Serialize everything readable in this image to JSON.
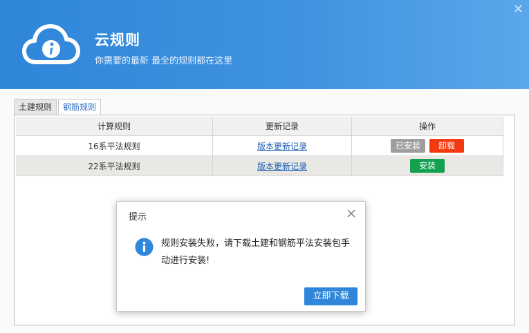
{
  "header": {
    "title": "云规则",
    "subtitle": "你需要的最新 最全的规则都在这里",
    "close_glyph": "✕",
    "logo_icon": "cloud-info-icon"
  },
  "tabs": [
    {
      "label": "土建规则",
      "active": false
    },
    {
      "label": "钢筋规则",
      "active": true
    }
  ],
  "table": {
    "columns": [
      "计算规则",
      "更新记录",
      "操作"
    ],
    "rows": [
      {
        "name": "16系平法规则",
        "log_link": "版本更新记录",
        "actions": [
          "已安装",
          "卸载"
        ]
      },
      {
        "name": "22系平法规则",
        "log_link": "版本更新记录",
        "actions": [
          "安装"
        ]
      }
    ]
  },
  "dialog": {
    "title": "提示",
    "message": "规则安装失败，请下载土建和钢筋平法安装包手动进行安装!",
    "button": "立即下载"
  },
  "colors": {
    "header_blue": "#3f92e0",
    "installed_gray": "#9e9e9e",
    "uninstall_red": "#f2390f",
    "install_green": "#13a150",
    "primary_button": "#2f86db",
    "link_blue": "#1e5fb4"
  }
}
